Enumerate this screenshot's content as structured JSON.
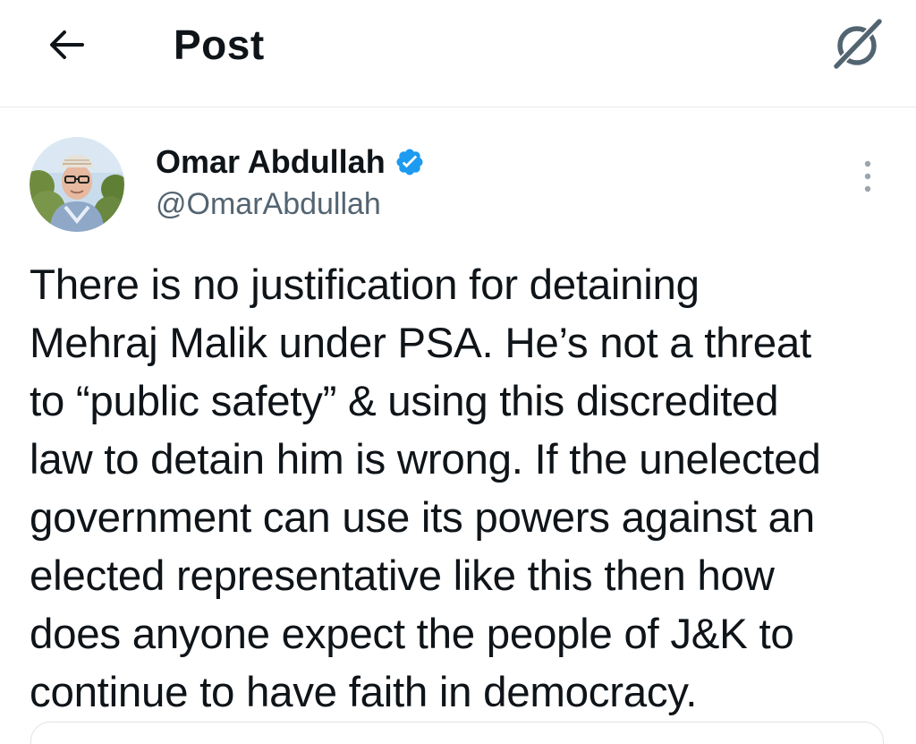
{
  "header": {
    "title": "Post"
  },
  "author": {
    "name": "Omar Abdullah",
    "handle": "@OmarAbdullah",
    "verified": true
  },
  "post": {
    "text": "There is no justification for detaining\nMehraj Malik under PSA. He’s not a threat\nto “public safety” & using this discredited\nlaw to detain him is wrong. If the unelected\ngovernment can use its powers against an\nelected representative like this then how\ndoes anyone expect the people of J&K to\ncontinue to have faith in democracy."
  },
  "icons": {
    "back": "arrow-left-icon",
    "grok": "grok-icon",
    "verified": "verified-badge-icon",
    "more": "more-vertical-icon"
  },
  "colors": {
    "text": "#0f1419",
    "secondary": "#536471",
    "verified": "#1d9bf0",
    "divider": "#e6e9eb"
  }
}
